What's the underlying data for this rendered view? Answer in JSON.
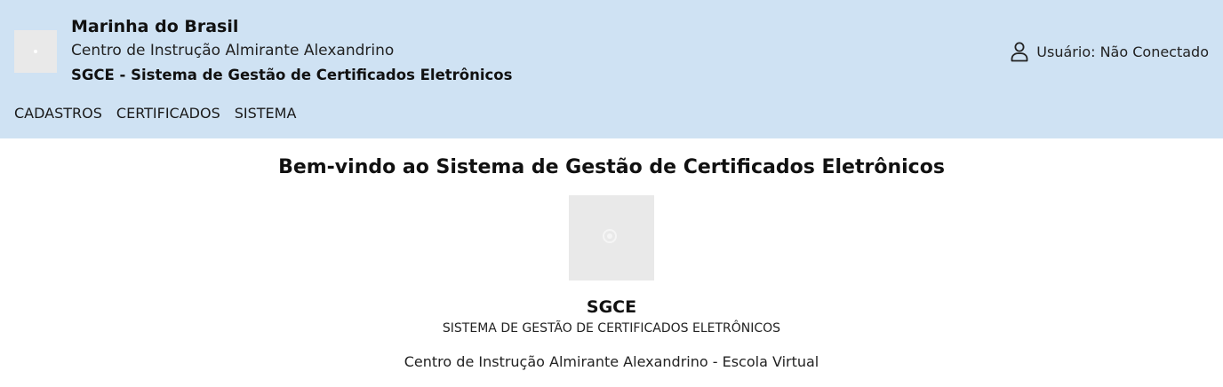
{
  "header": {
    "org_name": "Marinha do Brasil",
    "unit_name": "Centro de Instrução Almirante Alexandrino",
    "system_name": "SGCE - Sistema de Gestão de Certificados Eletrônicos",
    "logo_icon": "broken-image-icon",
    "user_icon": "user-icon",
    "user_status": "Usuário: Não Conectado",
    "background_color": "#cfe2f3"
  },
  "nav": {
    "items": [
      {
        "label": "CADASTROS"
      },
      {
        "label": "CERTIFICADOS"
      },
      {
        "label": "SISTEMA"
      }
    ]
  },
  "main": {
    "welcome_title": "Bem-vindo ao Sistema de Gestão de Certificados Eletrônicos",
    "logo_icon": "broken-image-icon",
    "app_name": "SGCE",
    "app_full_name": "SISTEMA DE GESTÃO DE CERTIFICADOS ELETRÔNICOS",
    "footer_line": "Centro de Instrução Almirante Alexandrino - Escola Virtual"
  }
}
